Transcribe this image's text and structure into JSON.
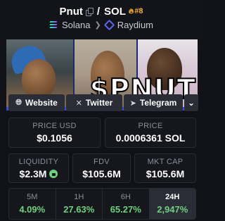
{
  "header": {
    "base_token": "Pnut",
    "separator": "/",
    "quote_token": "SOL",
    "rank": "#8",
    "chain": "Solana",
    "dex": "Raydium"
  },
  "banner": {
    "text": "$PNUT"
  },
  "social": {
    "website": "Website",
    "twitter": "Twitter",
    "telegram": "Telegram"
  },
  "stats": {
    "price_usd_label": "PRICE USD",
    "price_usd": "$0.1056",
    "price_sol_label": "PRICE",
    "price_sol": "0.0006361 SOL",
    "liquidity_label": "LIQUIDITY",
    "liquidity": "$2.3M",
    "fdv_label": "FDV",
    "fdv": "$105.6M",
    "mcap_label": "MKT CAP",
    "mcap": "$105.6M"
  },
  "timeframes": [
    {
      "label": "5M",
      "value": "4.09%"
    },
    {
      "label": "1H",
      "value": "27.63%"
    },
    {
      "label": "6H",
      "value": "65.27%"
    },
    {
      "label": "24H",
      "value": "2,947%"
    }
  ],
  "colors": {
    "background": "#111217",
    "positive": "#6fd17e",
    "rank": "#f3b23b",
    "button": "#2b2d36"
  }
}
